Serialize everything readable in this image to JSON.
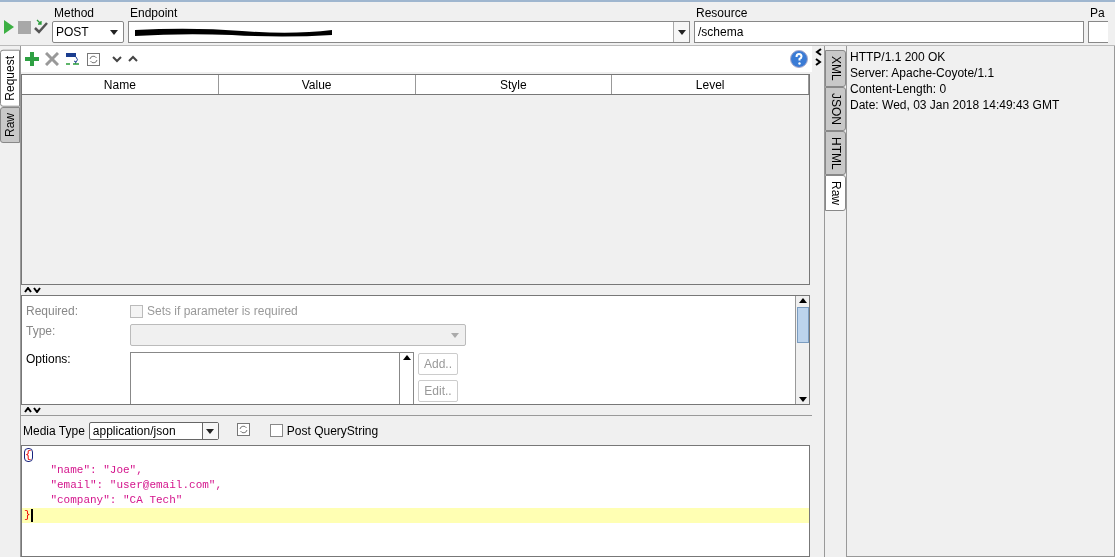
{
  "toolbar": {
    "method": {
      "label": "Method",
      "value": "POST"
    },
    "endpoint": {
      "label": "Endpoint"
    },
    "resource": {
      "label": "Resource",
      "value": "/schema"
    },
    "column_4": {
      "label": "Pa"
    }
  },
  "request_tabs": [
    {
      "label": "Request",
      "selected": true
    },
    {
      "label": "Raw",
      "selected": false
    }
  ],
  "params_table": {
    "columns": [
      "Name",
      "Value",
      "Style",
      "Level"
    ]
  },
  "param_details": {
    "required": {
      "label": "Required:",
      "checkbox_label": "Sets if parameter is required",
      "checked": false
    },
    "type": {
      "label": "Type:"
    },
    "options": {
      "label": "Options:",
      "buttons": [
        "Add..",
        "Edit.."
      ]
    }
  },
  "media_type": {
    "label": "Media Type",
    "value": "application/json",
    "post_querystring": {
      "label": "Post QueryString",
      "checked": false
    }
  },
  "body_lines": [
    {
      "text": "{",
      "kind": "brace",
      "current": false
    },
    {
      "text": "    \"name\": \"Joe\",",
      "kind": "pair",
      "current": false
    },
    {
      "text": "    \"email\": \"user@email.com\",",
      "kind": "pair",
      "current": false
    },
    {
      "text": "    \"company\": \"CA Tech\"",
      "kind": "pair",
      "current": false
    },
    {
      "text": "}",
      "kind": "brace",
      "current": true
    }
  ],
  "response_tabs": [
    {
      "label": "XML",
      "selected": false
    },
    {
      "label": "JSON",
      "selected": false
    },
    {
      "label": "HTML",
      "selected": false
    },
    {
      "label": "Raw",
      "selected": true
    }
  ],
  "response_lines": [
    "HTTP/1.1 200 OK",
    "Server: Apache-Coyote/1.1",
    "Content-Length: 0",
    "Date: Wed, 03 Jan 2018 14:49:43 GMT"
  ]
}
